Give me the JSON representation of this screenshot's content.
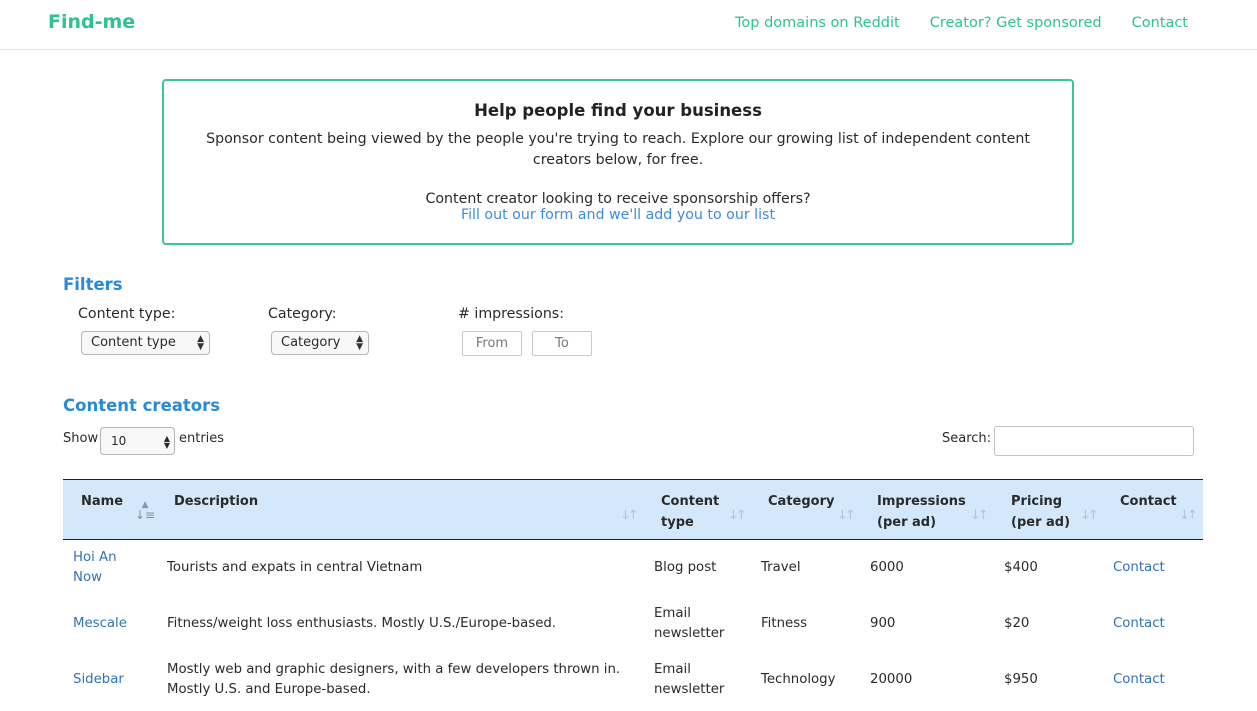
{
  "nav": {
    "brand": "Find-me",
    "links": [
      "Top domains on Reddit",
      "Creator? Get sponsored",
      "Contact"
    ]
  },
  "promo": {
    "title": "Help people find your business",
    "text": "Sponsor content being viewed by the people you're trying to reach. Explore our growing list of independent content creators below, for free.",
    "question": "Content creator looking to receive sponsorship offers?",
    "link": "Fill out our form and we'll add you to our list"
  },
  "filters": {
    "title": "Filters",
    "content_type_label": "Content type:",
    "content_type_value": "Content type",
    "category_label": "Category:",
    "category_value": "Category",
    "impressions_label": "# impressions:",
    "from_placeholder": "From",
    "to_placeholder": "To"
  },
  "creators": {
    "title": "Content creators",
    "show_label": "Show",
    "entries_value": "10",
    "entries_label": "entries",
    "search_label": "Search:"
  },
  "table": {
    "headers": {
      "name": "Name",
      "description": "Description",
      "content_type": [
        "Content",
        "type"
      ],
      "category": "Category",
      "impressions": [
        "Impressions",
        "(per ad)"
      ],
      "pricing": [
        "Pricing",
        "(per ad)"
      ],
      "contact": "Contact"
    },
    "rows": [
      {
        "name": [
          "Hoi An",
          "Now"
        ],
        "description": [
          "Tourists and expats in central Vietnam"
        ],
        "content_type": [
          "Blog post"
        ],
        "category": "Travel",
        "impressions": "6000",
        "pricing": "$400",
        "contact": "Contact"
      },
      {
        "name": [
          "Mescale"
        ],
        "description": [
          "Fitness/weight loss enthusiasts. Mostly U.S./Europe-based."
        ],
        "content_type": [
          "Email",
          "newsletter"
        ],
        "category": "Fitness",
        "impressions": "900",
        "pricing": "$20",
        "contact": "Contact"
      },
      {
        "name": [
          "Sidebar"
        ],
        "description": [
          "Mostly web and graphic designers, with a few developers thrown in.",
          "Mostly U.S. and Europe-based."
        ],
        "content_type": [
          "Email",
          "newsletter"
        ],
        "category": "Technology",
        "impressions": "20000",
        "pricing": "$950",
        "contact": "Contact"
      }
    ]
  }
}
